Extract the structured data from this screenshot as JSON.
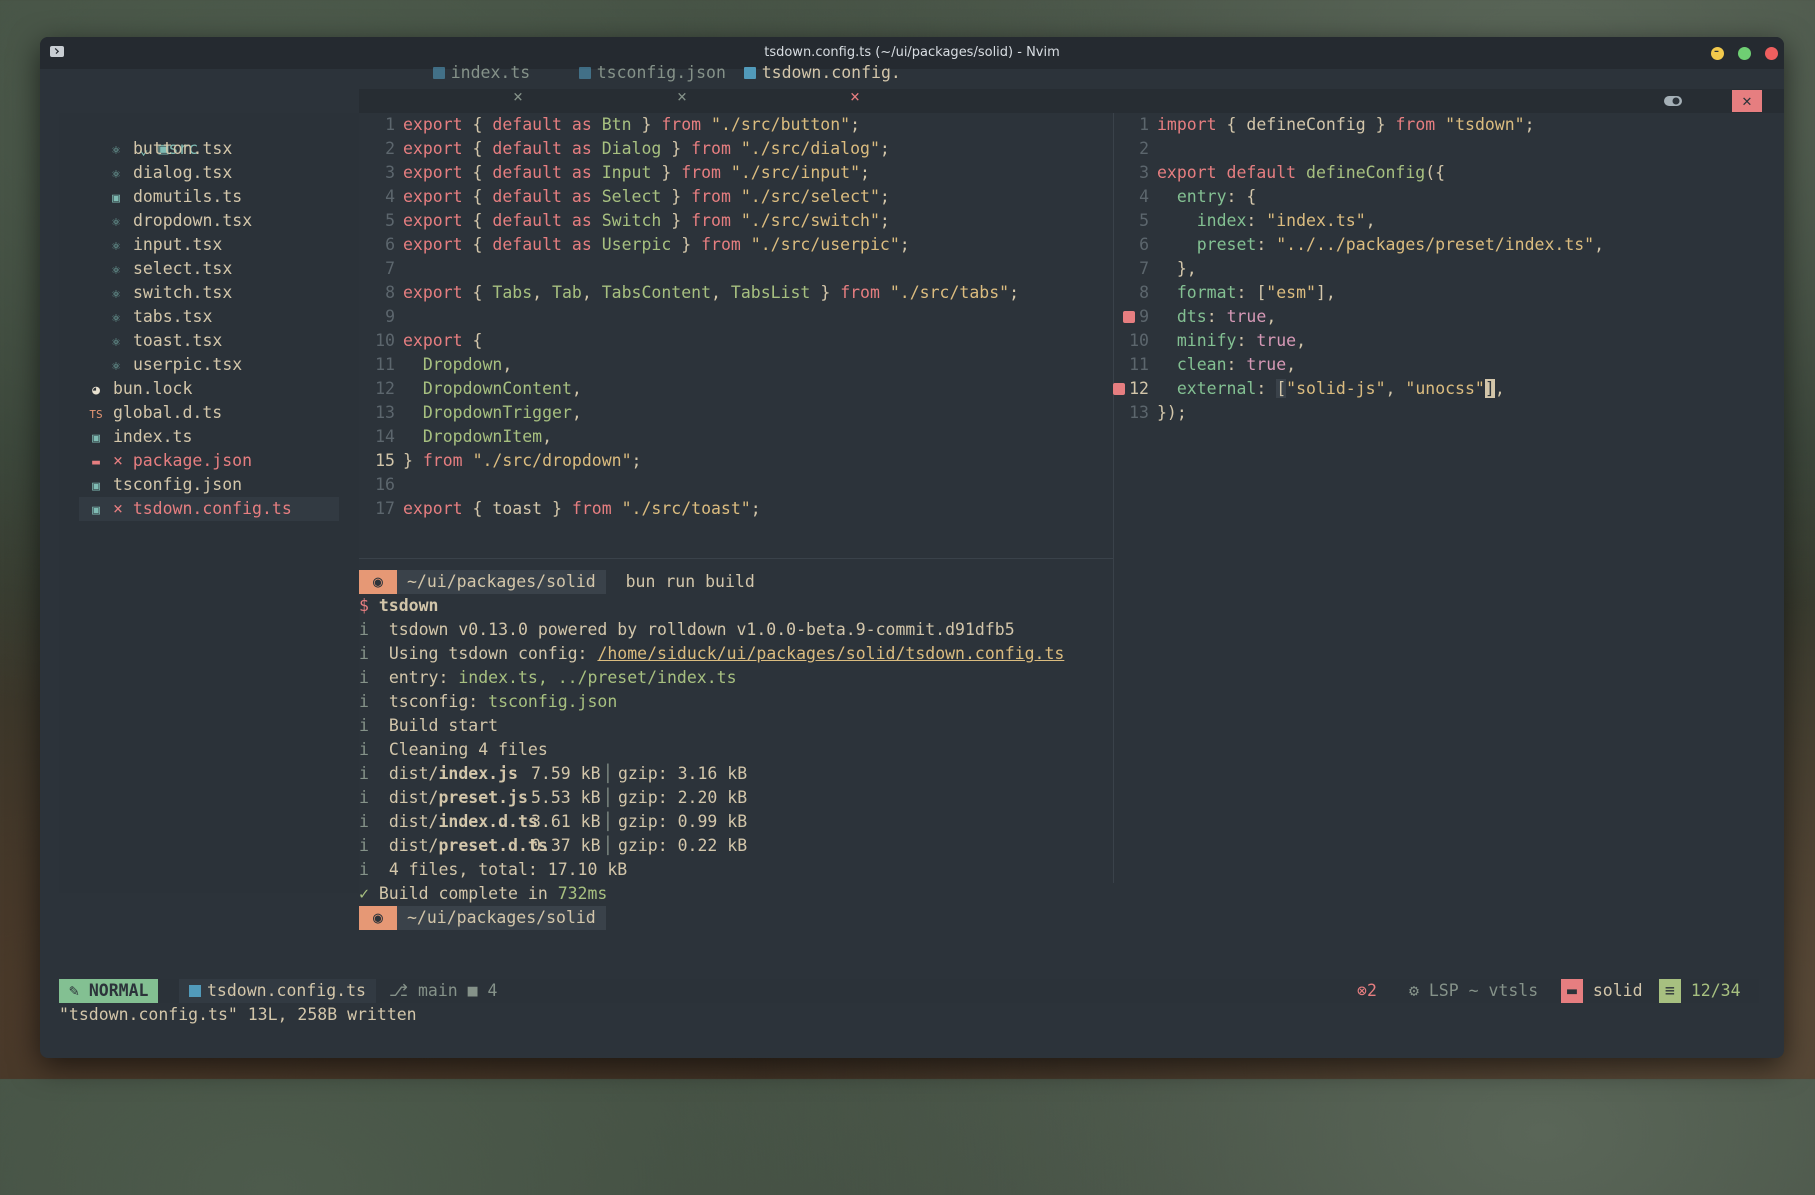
{
  "window": {
    "title": "tsdown.config.ts (~/ui/packages/solid) - Nvim"
  },
  "tree": {
    "root": "src",
    "src_items": [
      "button.tsx",
      "dialog.tsx",
      "domutils.ts",
      "dropdown.tsx",
      "input.tsx",
      "select.tsx",
      "switch.tsx",
      "tabs.tsx",
      "toast.tsx",
      "userpic.tsx"
    ],
    "items": [
      {
        "label": "bun.lock",
        "type": "bun"
      },
      {
        "label": "global.d.ts",
        "type": "tsdef"
      },
      {
        "label": "index.ts",
        "type": "ts"
      },
      {
        "label": "package.json",
        "type": "json",
        "error": true
      },
      {
        "label": "tsconfig.json",
        "type": "ts"
      },
      {
        "label": "tsdown.config.ts",
        "type": "ts",
        "error": true,
        "selected": true
      }
    ]
  },
  "tabs": [
    {
      "label": "index.ts",
      "active": false
    },
    {
      "label": "tsconfig.json",
      "active": false
    },
    {
      "label": "tsdown.config.",
      "active": true
    }
  ],
  "left_editor": {
    "current_line": 15,
    "lines": [
      "1",
      "2",
      "3",
      "4",
      "5",
      "6",
      "7",
      "8",
      "9",
      "10",
      "11",
      "12",
      "13",
      "14",
      "15",
      "16",
      "17"
    ]
  },
  "right_editor": {
    "current_line": 12
  },
  "terminal": {
    "prompt_path": "~/ui/packages/solid",
    "command": "bun run build",
    "lines": [
      "tsdown",
      "tsdown v0.13.0 powered by rolldown v1.0.0-beta.9-commit.d91dfb5",
      "Using tsdown config: ",
      "/home/siduck/ui/packages/solid/tsdown.config.ts",
      "entry: ",
      "index.ts, ../preset/index.ts",
      "tsconfig: ",
      "tsconfig.json",
      "Build start",
      "Cleaning 4 files",
      "4 files, total: 17.10 kB",
      "Build complete in ",
      "732ms"
    ],
    "files": [
      {
        "dir": "dist/",
        "name": "index.js",
        "size": "7.59 kB",
        "gzip": "gzip: 3.16 kB"
      },
      {
        "dir": "dist/",
        "name": "preset.js",
        "size": "5.53 kB",
        "gzip": "gzip: 2.20 kB"
      },
      {
        "dir": "dist/",
        "name": "index.d.ts",
        "size": "3.61 kB",
        "gzip": "gzip: 0.99 kB"
      },
      {
        "dir": "dist/",
        "name": "preset.d.ts",
        "size": "0.37 kB",
        "gzip": "gzip: 0.22 kB"
      }
    ]
  },
  "statusline": {
    "mode": "NORMAL",
    "file": "tsdown.config.ts",
    "branch": "main",
    "changes": "4",
    "errors": "2",
    "lsp": "LSP ~ vtsls",
    "dir": "solid",
    "position": "12/34"
  },
  "cmdline": "\"tsdown.config.ts\" 13L, 258B written",
  "colors": {
    "accent_green": "#83c092",
    "error": "#e67e80",
    "orange": "#e69875",
    "bg": "#2c333a"
  }
}
